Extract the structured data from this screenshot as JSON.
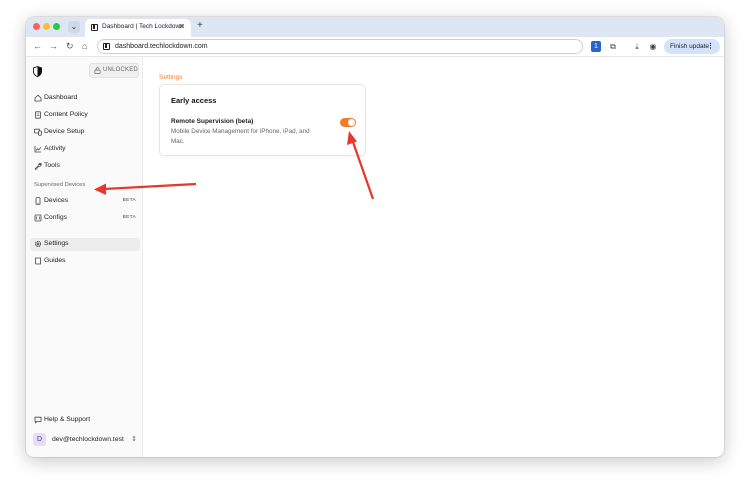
{
  "browser": {
    "tab_title": "Dashboard | Tech Lockdown",
    "tab_close": "✕",
    "new_tab": "+",
    "address": "dashboard.techlockdown.com",
    "finish_update": "Finish update",
    "search_tabs_glyph": "⌄",
    "back_glyph": "←",
    "forward_glyph": "→",
    "reload_glyph": "↻",
    "home_glyph": "⌂",
    "password_glyph": "1",
    "extensions_glyph": "⧉",
    "download_glyph": "⤓",
    "profile_glyph": "◉",
    "menu_glyph": "⋮"
  },
  "sidebar": {
    "lock_status": "UNLOCKED",
    "items": [
      {
        "label": "Dashboard",
        "icon": "home-icon"
      },
      {
        "label": "Content Policy",
        "icon": "document-icon"
      },
      {
        "label": "Device Setup",
        "icon": "devices-icon"
      },
      {
        "label": "Activity",
        "icon": "chart-icon"
      },
      {
        "label": "Tools",
        "icon": "wrench-icon"
      }
    ],
    "section_label": "Supervised Devices",
    "supervised_items": [
      {
        "label": "Devices",
        "badge": "BETA",
        "icon": "phone-icon"
      },
      {
        "label": "Configs",
        "badge": "BETA",
        "icon": "sliders-icon"
      }
    ],
    "bottom_items": [
      {
        "label": "Settings",
        "icon": "gear-icon",
        "active": true
      },
      {
        "label": "Guides",
        "icon": "book-icon"
      }
    ],
    "help_label": "Help & Support",
    "user": {
      "initial": "D",
      "email": "dev@techlockdown.test",
      "chevron": "⇕"
    }
  },
  "main": {
    "breadcrumb": "Settings",
    "card": {
      "title": "Early access",
      "option_title": "Remote Supervision (beta)",
      "option_description": "Mobile Device Management for iPhone, iPad, and Mac.",
      "toggle_on": true
    }
  },
  "colors": {
    "accent": "#f07b2a",
    "annotation_arrow": "#e8372a",
    "tabstrip": "#dfe6f3"
  }
}
